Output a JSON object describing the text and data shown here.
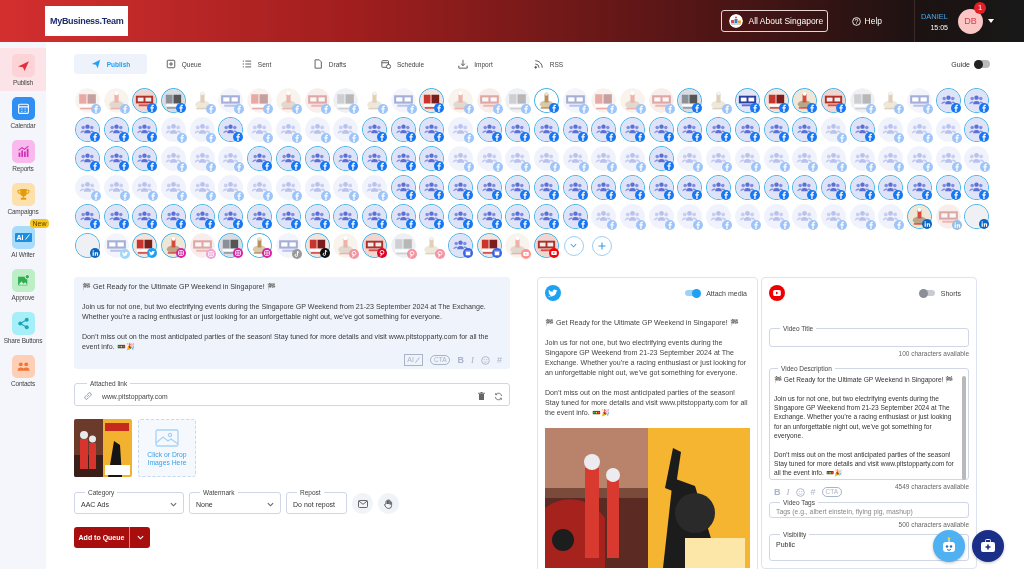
{
  "header": {
    "logo": "MyBusiness.Team",
    "workspace": "All About Singapore",
    "help": "Help",
    "user_name": "DANIEL",
    "time": "15:05",
    "user_initials": "DB",
    "notification_count": "1"
  },
  "sidebar": {
    "items": [
      {
        "label": "Publish",
        "selected": true
      },
      {
        "label": "Calendar",
        "selected": false
      },
      {
        "label": "Reports",
        "selected": false
      },
      {
        "label": "Campaigns",
        "selected": false
      },
      {
        "label": "AI Writer",
        "icon_text": "AI",
        "badge": "New",
        "selected": false
      },
      {
        "label": "Approve",
        "selected": false
      },
      {
        "label": "Share Buttons",
        "selected": false
      },
      {
        "label": "Contacts",
        "selected": false
      }
    ]
  },
  "tabs": [
    {
      "label": "Publish",
      "selected": true
    },
    {
      "label": "Queue",
      "selected": false
    },
    {
      "label": "Sent",
      "selected": false
    },
    {
      "label": "Drafts",
      "selected": false
    },
    {
      "label": "Schedule",
      "selected": false
    },
    {
      "label": "Import",
      "selected": false
    },
    {
      "label": "RSS",
      "selected": false
    }
  ],
  "guide": {
    "label": "Guide",
    "on": false
  },
  "accounts": [
    {
      "kind": "facebook_image",
      "selected": false
    },
    {
      "kind": "facebook_image",
      "selected": false
    },
    {
      "kind": "facebook_image",
      "selected": true
    },
    {
      "kind": "facebook_image",
      "selected": true
    },
    {
      "kind": "facebook_image",
      "selected": false
    },
    {
      "kind": "facebook_image",
      "selected": false
    },
    {
      "kind": "facebook_image",
      "selected": false
    },
    {
      "kind": "facebook_image",
      "selected": false
    },
    {
      "kind": "facebook_image",
      "selected": false
    },
    {
      "kind": "facebook_image",
      "selected": false
    },
    {
      "kind": "facebook_image",
      "selected": false
    },
    {
      "kind": "facebook_image",
      "selected": false
    },
    {
      "kind": "facebook_image",
      "selected": true
    },
    {
      "kind": "facebook_image",
      "selected": false
    },
    {
      "kind": "facebook_image",
      "selected": false
    },
    {
      "kind": "facebook_image",
      "selected": false
    },
    {
      "kind": "facebook_image",
      "selected": true
    },
    {
      "kind": "facebook_image",
      "selected": false
    },
    {
      "kind": "facebook_image",
      "selected": false
    },
    {
      "kind": "facebook_image",
      "selected": false
    },
    {
      "kind": "facebook_image",
      "selected": false
    },
    {
      "kind": "facebook_image",
      "selected": true
    },
    {
      "kind": "facebook_image",
      "selected": false
    },
    {
      "kind": "facebook_image",
      "selected": true
    },
    {
      "kind": "facebook_image",
      "selected": true
    },
    {
      "kind": "facebook_image",
      "selected": true
    },
    {
      "kind": "facebook_image",
      "selected": true
    },
    {
      "kind": "facebook_image",
      "selected": false
    },
    {
      "kind": "facebook_image",
      "selected": false
    },
    {
      "kind": "facebook_image",
      "selected": false
    },
    {
      "kind": "facebook_group",
      "selected": true
    },
    {
      "kind": "facebook_group",
      "selected": true
    },
    {
      "kind": "facebook_group",
      "selected": true
    },
    {
      "kind": "facebook_group",
      "selected": true
    },
    {
      "kind": "facebook_group",
      "selected": true
    },
    {
      "kind": "facebook_group",
      "selected": false
    },
    {
      "kind": "facebook_group",
      "selected": false
    },
    {
      "kind": "facebook_group",
      "selected": true
    },
    {
      "kind": "facebook_group",
      "selected": false
    },
    {
      "kind": "facebook_group",
      "selected": false
    },
    {
      "kind": "facebook_group",
      "selected": false
    },
    {
      "kind": "facebook_group",
      "selected": false
    },
    {
      "kind": "facebook_group",
      "selected": true
    },
    {
      "kind": "facebook_group",
      "selected": true
    },
    {
      "kind": "facebook_group",
      "selected": true
    },
    {
      "kind": "facebook_group",
      "selected": false
    },
    {
      "kind": "facebook_group",
      "selected": true
    },
    {
      "kind": "facebook_group",
      "selected": true
    },
    {
      "kind": "facebook_group",
      "selected": true
    },
    {
      "kind": "facebook_group",
      "selected": true
    },
    {
      "kind": "facebook_group",
      "selected": true
    },
    {
      "kind": "facebook_group",
      "selected": true
    },
    {
      "kind": "facebook_group",
      "selected": true
    },
    {
      "kind": "facebook_group",
      "selected": true
    },
    {
      "kind": "facebook_group",
      "selected": true
    },
    {
      "kind": "facebook_group",
      "selected": true
    },
    {
      "kind": "facebook_group",
      "selected": true
    },
    {
      "kind": "facebook_group",
      "selected": true
    },
    {
      "kind": "facebook_group",
      "selected": false
    },
    {
      "kind": "facebook_group",
      "selected": true
    },
    {
      "kind": "facebook_group",
      "selected": false
    },
    {
      "kind": "facebook_group",
      "selected": false
    },
    {
      "kind": "facebook_group",
      "selected": false
    },
    {
      "kind": "facebook_group",
      "selected": true
    },
    {
      "kind": "facebook_group",
      "selected": true
    },
    {
      "kind": "facebook_group",
      "selected": true
    },
    {
      "kind": "facebook_group",
      "selected": true
    },
    {
      "kind": "facebook_group",
      "selected": false
    },
    {
      "kind": "facebook_group",
      "selected": false
    },
    {
      "kind": "facebook_group",
      "selected": false
    },
    {
      "kind": "facebook_group",
      "selected": true
    },
    {
      "kind": "facebook_group",
      "selected": true
    },
    {
      "kind": "facebook_group",
      "selected": true
    },
    {
      "kind": "facebook_group",
      "selected": true
    },
    {
      "kind": "facebook_group",
      "selected": true
    },
    {
      "kind": "facebook_group",
      "selected": true
    },
    {
      "kind": "facebook_group",
      "selected": true
    },
    {
      "kind": "facebook_group",
      "selected": false
    },
    {
      "kind": "facebook_group",
      "selected": false
    },
    {
      "kind": "facebook_group",
      "selected": false
    },
    {
      "kind": "facebook_group",
      "selected": false
    },
    {
      "kind": "facebook_group",
      "selected": false
    },
    {
      "kind": "facebook_group",
      "selected": false
    },
    {
      "kind": "facebook_group",
      "selected": false
    },
    {
      "kind": "facebook_group",
      "selected": true
    },
    {
      "kind": "facebook_group",
      "selected": false
    },
    {
      "kind": "facebook_group",
      "selected": false
    },
    {
      "kind": "facebook_group",
      "selected": false
    },
    {
      "kind": "facebook_group",
      "selected": false
    },
    {
      "kind": "facebook_group",
      "selected": false
    },
    {
      "kind": "facebook_group",
      "selected": false
    },
    {
      "kind": "facebook_group",
      "selected": false
    },
    {
      "kind": "facebook_group",
      "selected": false
    },
    {
      "kind": "facebook_group",
      "selected": false
    },
    {
      "kind": "facebook_group",
      "selected": false
    },
    {
      "kind": "facebook_group",
      "selected": false
    },
    {
      "kind": "facebook_group",
      "selected": false
    },
    {
      "kind": "facebook_group",
      "selected": false
    },
    {
      "kind": "facebook_group",
      "selected": false
    },
    {
      "kind": "facebook_group",
      "selected": false
    },
    {
      "kind": "facebook_group",
      "selected": false
    },
    {
      "kind": "facebook_group",
      "selected": false
    },
    {
      "kind": "facebook_group",
      "selected": false
    },
    {
      "kind": "facebook_group",
      "selected": false
    },
    {
      "kind": "facebook_group",
      "selected": false
    },
    {
      "kind": "facebook_group",
      "selected": false
    },
    {
      "kind": "facebook_group",
      "selected": false
    },
    {
      "kind": "facebook_group",
      "selected": true
    },
    {
      "kind": "facebook_group",
      "selected": true
    },
    {
      "kind": "facebook_group",
      "selected": true
    },
    {
      "kind": "facebook_group",
      "selected": true
    },
    {
      "kind": "facebook_group",
      "selected": true
    },
    {
      "kind": "facebook_group",
      "selected": true
    },
    {
      "kind": "facebook_group",
      "selected": true
    },
    {
      "kind": "facebook_group",
      "selected": true
    },
    {
      "kind": "facebook_group",
      "selected": true
    },
    {
      "kind": "facebook_group",
      "selected": true
    },
    {
      "kind": "facebook_group",
      "selected": true
    },
    {
      "kind": "facebook_group",
      "selected": true
    },
    {
      "kind": "facebook_group",
      "selected": true
    },
    {
      "kind": "facebook_group",
      "selected": true
    },
    {
      "kind": "facebook_group",
      "selected": true
    },
    {
      "kind": "facebook_group",
      "selected": true
    },
    {
      "kind": "facebook_group",
      "selected": true
    },
    {
      "kind": "facebook_group",
      "selected": true
    },
    {
      "kind": "facebook_group",
      "selected": true
    },
    {
      "kind": "facebook_group",
      "selected": true
    },
    {
      "kind": "facebook_group",
      "selected": true
    },
    {
      "kind": "facebook_group",
      "selected": true
    },
    {
      "kind": "facebook_group",
      "selected": true
    },
    {
      "kind": "facebook_group",
      "selected": true
    },
    {
      "kind": "facebook_group",
      "selected": true
    },
    {
      "kind": "facebook_group",
      "selected": true
    },
    {
      "kind": "facebook_group",
      "selected": true
    },
    {
      "kind": "facebook_group",
      "selected": true
    },
    {
      "kind": "facebook_group",
      "selected": true
    },
    {
      "kind": "facebook_group",
      "selected": true
    },
    {
      "kind": "facebook_group",
      "selected": true
    },
    {
      "kind": "facebook_group",
      "selected": true
    },
    {
      "kind": "facebook_group",
      "selected": true
    },
    {
      "kind": "facebook_group",
      "selected": true
    },
    {
      "kind": "facebook_group",
      "selected": true
    },
    {
      "kind": "facebook_group",
      "selected": true
    },
    {
      "kind": "facebook_group",
      "selected": true
    },
    {
      "kind": "facebook_group",
      "selected": true
    },
    {
      "kind": "facebook_group",
      "selected": true
    },
    {
      "kind": "facebook_group",
      "selected": false
    },
    {
      "kind": "facebook_group",
      "selected": false
    },
    {
      "kind": "facebook_group",
      "selected": false
    },
    {
      "kind": "facebook_group",
      "selected": false
    },
    {
      "kind": "facebook_group",
      "selected": false
    },
    {
      "kind": "facebook_group",
      "selected": false
    },
    {
      "kind": "facebook_group",
      "selected": false
    },
    {
      "kind": "facebook_group",
      "selected": false
    },
    {
      "kind": "facebook_group",
      "selected": false
    },
    {
      "kind": "facebook_group",
      "selected": false
    },
    {
      "kind": "facebook_group",
      "selected": false
    },
    {
      "kind": "linkedin_image",
      "selected": true
    },
    {
      "kind": "linkedin_image",
      "selected": false
    },
    {
      "kind": "linkedin_blank",
      "selected": true
    },
    {
      "kind": "linkedin_blank",
      "selected": true
    },
    {
      "kind": "twitter_image",
      "selected": false
    },
    {
      "kind": "twitter_image",
      "selected": true
    },
    {
      "kind": "instagram_image",
      "selected": true
    },
    {
      "kind": "instagram_image",
      "selected": false
    },
    {
      "kind": "instagram_image",
      "selected": true
    },
    {
      "kind": "instagram_image",
      "selected": true
    },
    {
      "kind": "tiktok_image",
      "selected": false
    },
    {
      "kind": "tiktok_image",
      "selected": true
    },
    {
      "kind": "pinterest_image",
      "selected": false
    },
    {
      "kind": "pinterest_image",
      "selected": true
    },
    {
      "kind": "pinterest_image",
      "selected": false
    },
    {
      "kind": "pinterest_image",
      "selected": false
    },
    {
      "kind": "business_group",
      "selected": true
    },
    {
      "kind": "business_image",
      "selected": true
    },
    {
      "kind": "youtube_image",
      "selected": false
    },
    {
      "kind": "youtube_image",
      "selected": true
    }
  ],
  "composer": {
    "text": [
      "🏁 Get Ready for the Ultimate GP Weekend in Singapore! 🏁",
      "Join us for not one, but two electrifying events during the Singapore GP Weekend from 21-23 September 2024 at The Exchange. Whether you’re a racing enthusiast or just looking for an unforgettable night out, we’ve got something for everyone.",
      "Don’t miss out on the most anticipated parties of the season! Stay tuned for more details and visit www.pitstopparty.com for all the event info. 🚥🎉"
    ],
    "toolbar": [
      {
        "kind": "ai",
        "label": "AI"
      },
      {
        "kind": "cta",
        "label": "CTA"
      },
      {
        "kind": "bold",
        "label": "B"
      },
      {
        "kind": "italic",
        "label": "I"
      },
      {
        "kind": "emoji"
      },
      {
        "kind": "hash",
        "label": "#"
      }
    ],
    "attached_link": {
      "label": "Attached link",
      "value": "www.pitstopparty.com"
    },
    "drop_label": "Click or Drop Images Here",
    "category": {
      "label": "Category",
      "value": "AAC Ads"
    },
    "watermark": {
      "label": "Watermark",
      "value": "None"
    },
    "repost": {
      "label": "Repost",
      "value": "Do not repost"
    },
    "submit": "Add to Queue"
  },
  "twitter": {
    "attach_media": {
      "label": "Attach media",
      "on": true
    },
    "text": [
      "🏁 Get Ready for the Ultimate GP Weekend in Singapore! 🏁",
      "Join us for not one, but two electrifying events during the Singapore GP Weekend from 21-23 September 2024 at The Exchange. Whether you’re a racing enthusiast or just looking for an unforgettable night out, we’ve got something for everyone.",
      "Don’t miss out on the most anticipated parties of the season! Stay tuned for more details and visit www.pitstopparty.com for all the event info. 🚥🎉"
    ]
  },
  "youtube": {
    "shorts": {
      "label": "Shorts",
      "on": false
    },
    "title": {
      "label": "Video Title",
      "counter": "100 characters available"
    },
    "description": {
      "label": "Video Description",
      "text": [
        "🏁 Get Ready for the Ultimate GP Weekend in Singapore! 🏁",
        "Join us for not one, but two electrifying events during the Singapore GP Weekend from 21-23 September 2024 at The Exchange. Whether you’re a racing enthusiast or just looking for an unforgettable night out, we’ve got something for everyone.",
        "Don’t miss out on the most anticipated parties of the season! Stay tuned for more details and visit www.pitstopparty.com for all the event info. 🚥🎉"
      ],
      "toolbar": [
        {
          "kind": "bold",
          "label": "B"
        },
        {
          "kind": "italic",
          "label": "I"
        },
        {
          "kind": "emoji"
        },
        {
          "kind": "hash",
          "label": "#"
        },
        {
          "kind": "cta",
          "label": "CTA"
        }
      ],
      "counter": "4549 characters available"
    },
    "tags": {
      "label": "Video Tags",
      "placeholder": "Tags (e.g., albert einstein, flying pig, mashup)",
      "counter": "500 characters available"
    },
    "visibility": {
      "label": "Visibility",
      "value": "Public"
    }
  }
}
